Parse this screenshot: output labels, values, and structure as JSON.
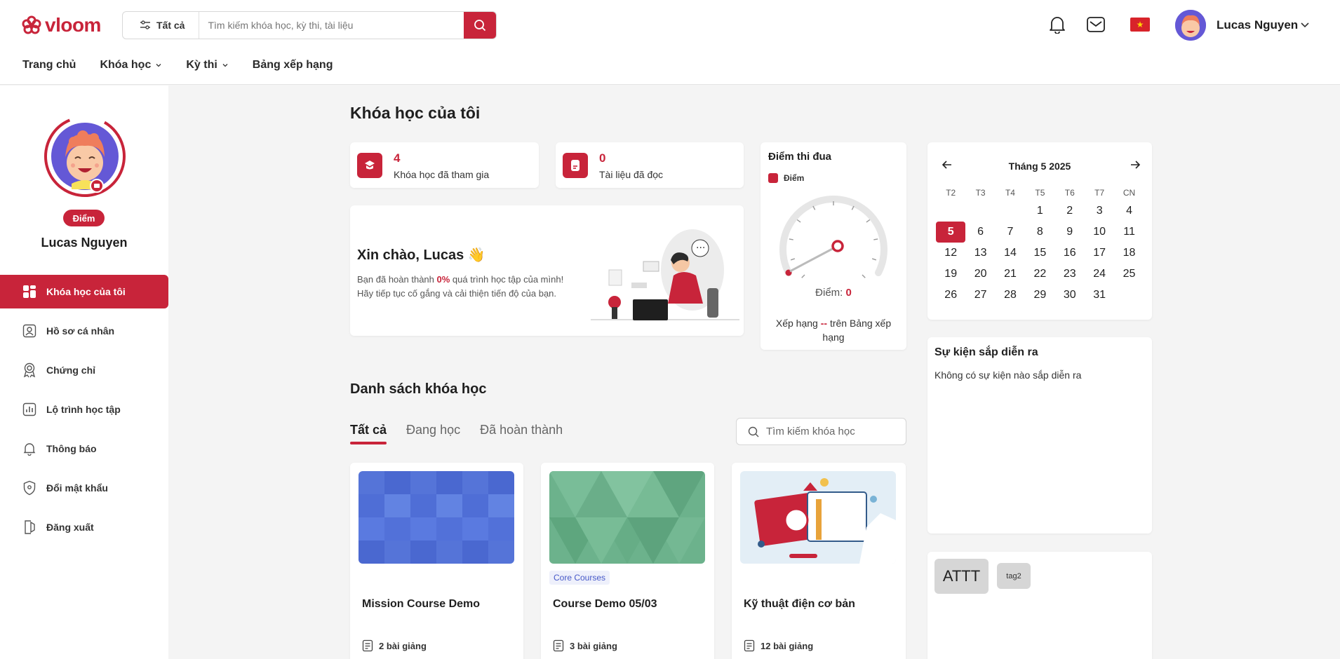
{
  "brand": {
    "name": "vloom",
    "accent": "#c8243a"
  },
  "header": {
    "filter_label": "Tất cả",
    "search_placeholder": "Tìm kiếm khóa học, kỳ thi, tài liệu",
    "user_name": "Lucas Nguyen",
    "icons": [
      "bell-icon",
      "mail-icon",
      "vietnam-flag-icon",
      "avatar",
      "chevron-down-icon"
    ]
  },
  "nav": [
    {
      "label": "Trang chủ",
      "dropdown": false
    },
    {
      "label": "Khóa học",
      "dropdown": true
    },
    {
      "label": "Kỳ thi",
      "dropdown": true
    },
    {
      "label": "Bảng xếp hạng",
      "dropdown": false
    }
  ],
  "sidebar": {
    "badge": "Điểm",
    "name": "Lucas Nguyen",
    "items": [
      {
        "label": "Khóa học của tôi",
        "icon": "grid-icon",
        "active": true
      },
      {
        "label": "Hồ sơ cá nhân",
        "icon": "user-card-icon",
        "active": false
      },
      {
        "label": "Chứng chỉ",
        "icon": "certificate-icon",
        "active": false
      },
      {
        "label": "Lộ trình học tập",
        "icon": "chart-icon",
        "active": false
      },
      {
        "label": "Thông báo",
        "icon": "bell-icon",
        "active": false
      },
      {
        "label": "Đổi mật khẩu",
        "icon": "shield-icon",
        "active": false
      },
      {
        "label": "Đăng xuất",
        "icon": "logout-icon",
        "active": false
      }
    ]
  },
  "main": {
    "title": "Khóa học của tôi",
    "stats": [
      {
        "value": "4",
        "label": "Khóa học đã tham gia",
        "icon": "course-icon"
      },
      {
        "value": "0",
        "label": "Tài liệu đã đọc",
        "icon": "document-icon"
      }
    ],
    "welcome": {
      "title": "Xin chào, Lucas 👋",
      "line1_prefix": "Bạn đã hoàn thành ",
      "line1_percent": "0%",
      "line1_suffix": " quá trình học tập của mình!",
      "line2": "Hãy tiếp tục cố gắng và cải thiện tiến độ của bạn."
    },
    "gauge": {
      "title": "Điểm thi đua",
      "legend": "Điểm",
      "score_label": "Điểm:",
      "score_value": "0",
      "rank_prefix": "Xếp hạng",
      "rank_value": "--",
      "rank_suffix": "trên Bảng xếp hạng"
    },
    "courses": {
      "section_title": "Danh sách khóa học",
      "tabs": [
        "Tất cả",
        "Đang học",
        "Đã hoàn thành"
      ],
      "active_tab": "Tất cả",
      "search_placeholder": "Tìm kiếm khóa học",
      "items": [
        {
          "name": "Mission Course Demo",
          "lessons": "2 bài giảng",
          "tag": "",
          "thumb": "blue-mosaic"
        },
        {
          "name": "Course Demo 05/03",
          "lessons": "3 bài giảng",
          "tag": "Core Courses",
          "thumb": "green-triangles"
        },
        {
          "name": "Kỹ thuật điện cơ bản",
          "lessons": "12 bài giảng",
          "tag": "",
          "thumb": "education-illustration"
        }
      ]
    }
  },
  "calendar": {
    "title": "Tháng 5 2025",
    "weekdays": [
      "T2",
      "T3",
      "T4",
      "T5",
      "T6",
      "T7",
      "CN"
    ],
    "leading_blanks": 3,
    "days": [
      "1",
      "2",
      "3",
      "4",
      "5",
      "6",
      "7",
      "8",
      "9",
      "10",
      "11",
      "12",
      "13",
      "14",
      "15",
      "16",
      "17",
      "18",
      "19",
      "20",
      "21",
      "22",
      "23",
      "24",
      "25",
      "26",
      "27",
      "28",
      "29",
      "30",
      "31"
    ],
    "today": "5"
  },
  "events": {
    "title": "Sự kiện sắp diễn ra",
    "empty": "Không có sự kiện nào sắp diễn ra"
  },
  "tags": [
    "ATTT",
    "tag2"
  ]
}
